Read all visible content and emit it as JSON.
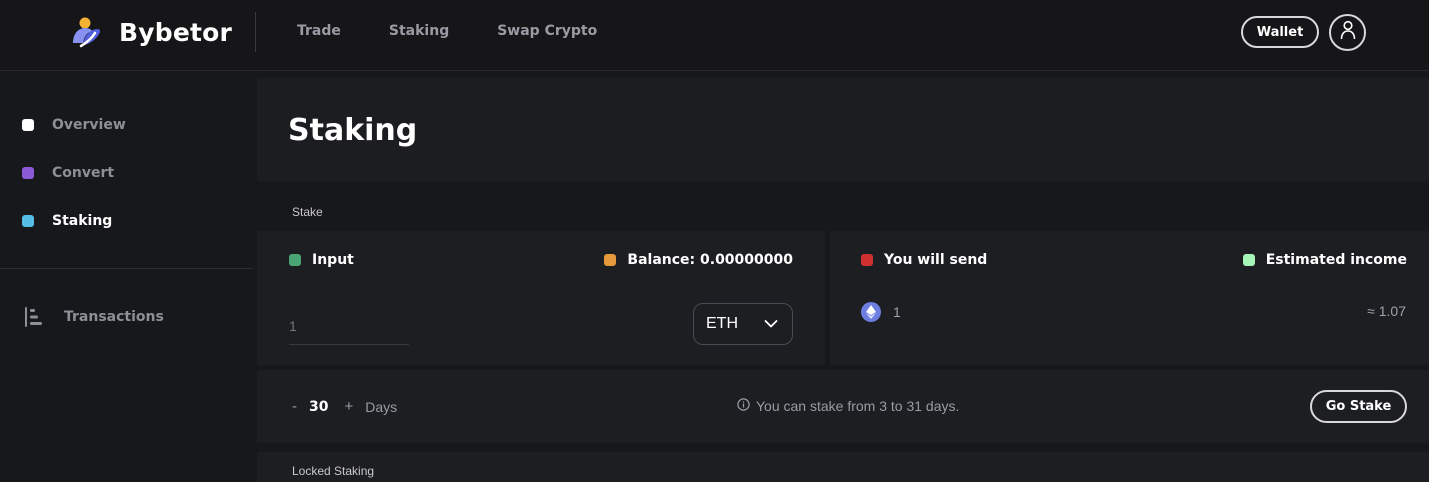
{
  "brand": {
    "name": "Bybetor",
    "logo_icon": "bybetor-logo-icon"
  },
  "topnav": {
    "items": [
      {
        "label": "Trade"
      },
      {
        "label": "Staking"
      },
      {
        "label": "Swap Crypto"
      }
    ]
  },
  "header": {
    "wallet_label": "Wallet",
    "account_icon": "user-icon"
  },
  "sidebar": {
    "items": [
      {
        "label": "Overview",
        "color": "#ffffff",
        "active": false
      },
      {
        "label": "Convert",
        "color": "#8c5ad6",
        "active": false
      },
      {
        "label": "Staking",
        "color": "#56bde6",
        "active": true
      }
    ],
    "transactions_label": "Transactions",
    "transactions_icon": "list-icon"
  },
  "main": {
    "title": "Staking",
    "stake_section_label": "Stake",
    "input_card": {
      "input_label": "Input",
      "input_color": "#4aa574",
      "balance_label": "Balance: 0.00000000",
      "balance_color": "#e49a3c",
      "amount_placeholder": "1",
      "coin": "ETH"
    },
    "send_card": {
      "send_label": "You will send",
      "send_color": "#d0302f",
      "income_label": "Estimated income",
      "income_color": "#a6f5b9",
      "send_amount": "1",
      "coin_icon": "ethereum-icon",
      "estimated_value": "≈ 1.07"
    },
    "days": {
      "minus": "-",
      "value": "30",
      "plus": "+",
      "unit": "Days",
      "info_text": "You can stake from 3 to 31 days.",
      "go_label": "Go Stake"
    },
    "locked_section_label": "Locked Staking"
  }
}
